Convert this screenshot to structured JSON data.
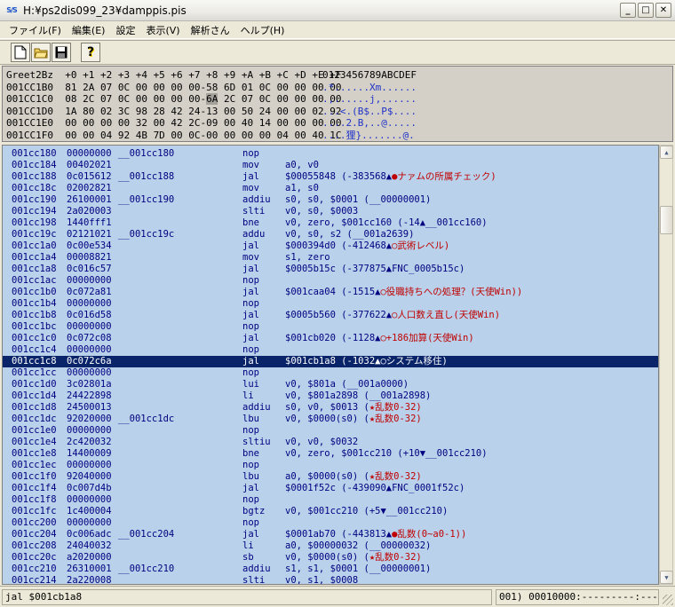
{
  "window": {
    "icon_text": "S/S",
    "title": "H:¥ps2dis099_23¥damppis.pis",
    "buttons": [
      "_",
      "□",
      "✕"
    ]
  },
  "menu": [
    "ファイル(F)",
    "編集(E)",
    "設定",
    "表示(V)",
    "解析さん",
    "ヘルプ(H)"
  ],
  "toolbar": {
    "icons": [
      "new-file-icon",
      "open-folder-icon",
      "save-disk-icon",
      "help-icon"
    ],
    "help_glyph": "?"
  },
  "dump": {
    "header": {
      "hex": "Greet2Bz  +0 +1 +2 +3 +4 +5 +6 +7 +8 +9 +A +B +C +D +E +F",
      "ascii": "0123456789ABCDEF"
    },
    "rows": [
      {
        "pre": "001CC1B0  81 2A 07 0C 00 00 00 00-58 6D 01 0C 00 00 00 00",
        "hl": "",
        "post": "",
        "ascii": ".*......Xm......"
      },
      {
        "pre": "001CC1C0  08 2C 07 0C 00 00 00 00-",
        "hl": "6A",
        "post": " 2C 07 0C 00 00 00 00",
        "ascii": ".,......j,......"
      },
      {
        "pre": "001CC1D0  1A 80 02 3C 98 28 42 24-13 00 50 24 00 00 02 92",
        "hl": "",
        "post": "",
        "ascii": "...<.(B$..P$...."
      },
      {
        "pre": "001CC1E0  00 00 00 00 32 00 42 2C-09 00 40 14 00 00 00 00",
        "hl": "",
        "post": "",
        "ascii": "....2.B,..@....."
      },
      {
        "pre": "001CC1F0  00 00 04 92 4B 7D 00 0C-00 00 00 00 04 00 40 1C",
        "hl": "",
        "post": "",
        "ascii": "....狸}.......@."
      }
    ]
  },
  "code": {
    "selected_index": 18,
    "rows": [
      {
        "addr": "001cc180",
        "word": "00000000",
        "label": "__001cc180",
        "op": "nop",
        "args": "",
        "comment": ""
      },
      {
        "addr": "001cc184",
        "word": "00402021",
        "label": "",
        "op": "mov",
        "args": "a0, v0",
        "comment": ""
      },
      {
        "addr": "001cc188",
        "word": "0c015612",
        "label": "__001cc188",
        "op": "jal",
        "args": "$00055848 (-383568▲",
        "comment": "●ナァムの所属チェック)"
      },
      {
        "addr": "001cc18c",
        "word": "02002821",
        "label": "",
        "op": "mov",
        "args": "a1, s0",
        "comment": ""
      },
      {
        "addr": "001cc190",
        "word": "26100001",
        "label": "__001cc190",
        "op": "addiu",
        "args": "s0, s0, $0001 (__00000001)",
        "comment": ""
      },
      {
        "addr": "001cc194",
        "word": "2a020003",
        "label": "",
        "op": "slti",
        "args": "v0, s0, $0003",
        "comment": ""
      },
      {
        "addr": "001cc198",
        "word": "1440fff1",
        "label": "",
        "op": "bne",
        "args": "v0, zero, $001cc160 (-14▲__001cc160)",
        "comment": ""
      },
      {
        "addr": "001cc19c",
        "word": "02121021",
        "label": "__001cc19c",
        "op": "addu",
        "args": "v0, s0, s2 (__001a2639)",
        "comment": ""
      },
      {
        "addr": "001cc1a0",
        "word": "0c00e534",
        "label": "",
        "op": "jal",
        "args": "$000394d0 (-412468▲",
        "comment": "○武術レベル)"
      },
      {
        "addr": "001cc1a4",
        "word": "00008821",
        "label": "",
        "op": "mov",
        "args": "s1, zero",
        "comment": ""
      },
      {
        "addr": "001cc1a8",
        "word": "0c016c57",
        "label": "",
        "op": "jal",
        "args": "$0005b15c (-377875▲FNC_0005b15c)",
        "comment": ""
      },
      {
        "addr": "001cc1ac",
        "word": "00000000",
        "label": "",
        "op": "nop",
        "args": "",
        "comment": ""
      },
      {
        "addr": "001cc1b0",
        "word": "0c072a81",
        "label": "",
        "op": "jal",
        "args": "$001caa04 (-1515▲",
        "comment": "○役職持ちへの処理？(天使Win))"
      },
      {
        "addr": "001cc1b4",
        "word": "00000000",
        "label": "",
        "op": "nop",
        "args": "",
        "comment": ""
      },
      {
        "addr": "001cc1b8",
        "word": "0c016d58",
        "label": "",
        "op": "jal",
        "args": "$0005b560 (-377622▲",
        "comment": "○人口数え直し(天使Win)"
      },
      {
        "addr": "001cc1bc",
        "word": "00000000",
        "label": "",
        "op": "nop",
        "args": "",
        "comment": ""
      },
      {
        "addr": "001cc1c0",
        "word": "0c072c08",
        "label": "",
        "op": "jal",
        "args": "$001cb020 (-1128▲",
        "comment": "○+186加算(天使Win)"
      },
      {
        "addr": "001cc1c4",
        "word": "00000000",
        "label": "",
        "op": "nop",
        "args": "",
        "comment": ""
      },
      {
        "addr": "001cc1c8",
        "word": "0c072c6a",
        "label": "",
        "op": "jal",
        "args": "$001cb1a8 (-1032▲",
        "comment": "○システム移住)"
      },
      {
        "addr": "001cc1cc",
        "word": "00000000",
        "label": "",
        "op": "nop",
        "args": "",
        "comment": ""
      },
      {
        "addr": "001cc1d0",
        "word": "3c02801a",
        "label": "",
        "op": "lui",
        "args": "v0, $801a (__001a0000)",
        "comment": ""
      },
      {
        "addr": "001cc1d4",
        "word": "24422898",
        "label": "",
        "op": "li",
        "args": "v0, $801a2898 (__001a2898)",
        "comment": ""
      },
      {
        "addr": "001cc1d8",
        "word": "24500013",
        "label": "",
        "op": "addiu",
        "args": "s0, v0, $0013 (",
        "comment": "★乱数0-32)"
      },
      {
        "addr": "001cc1dc",
        "word": "92020000",
        "label": "__001cc1dc",
        "op": "lbu",
        "args": "v0, $0000(s0) (",
        "comment": "★乱数0-32)"
      },
      {
        "addr": "001cc1e0",
        "word": "00000000",
        "label": "",
        "op": "nop",
        "args": "",
        "comment": ""
      },
      {
        "addr": "001cc1e4",
        "word": "2c420032",
        "label": "",
        "op": "sltiu",
        "args": "v0, v0, $0032",
        "comment": ""
      },
      {
        "addr": "001cc1e8",
        "word": "14400009",
        "label": "",
        "op": "bne",
        "args": "v0, zero, $001cc210 (+10▼__001cc210)",
        "comment": ""
      },
      {
        "addr": "001cc1ec",
        "word": "00000000",
        "label": "",
        "op": "nop",
        "args": "",
        "comment": ""
      },
      {
        "addr": "001cc1f0",
        "word": "92040000",
        "label": "",
        "op": "lbu",
        "args": "a0, $0000(s0) (",
        "comment": "★乱数0-32)"
      },
      {
        "addr": "001cc1f4",
        "word": "0c007d4b",
        "label": "",
        "op": "jal",
        "args": "$0001f52c (-439090▲FNC_0001f52c)",
        "comment": ""
      },
      {
        "addr": "001cc1f8",
        "word": "00000000",
        "label": "",
        "op": "nop",
        "args": "",
        "comment": ""
      },
      {
        "addr": "001cc1fc",
        "word": "1c400004",
        "label": "",
        "op": "bgtz",
        "args": "v0, $001cc210 (+5▼__001cc210)",
        "comment": ""
      },
      {
        "addr": "001cc200",
        "word": "00000000",
        "label": "",
        "op": "nop",
        "args": "",
        "comment": ""
      },
      {
        "addr": "001cc204",
        "word": "0c006adc",
        "label": "__001cc204",
        "op": "jal",
        "args": "$0001ab70 (-443813▲",
        "comment": "●乱数(0~a0-1))"
      },
      {
        "addr": "001cc208",
        "word": "24040032",
        "label": "",
        "op": "li",
        "args": "a0, $00000032 (__00000032)",
        "comment": ""
      },
      {
        "addr": "001cc20c",
        "word": "a2020000",
        "label": "",
        "op": "sb",
        "args": "v0, $0000(s0) (",
        "comment": "★乱数0-32)"
      },
      {
        "addr": "001cc210",
        "word": "26310001",
        "label": "__001cc210",
        "op": "addiu",
        "args": "s1, s1, $0001 (__00000001)",
        "comment": ""
      },
      {
        "addr": "001cc214",
        "word": "2a220008",
        "label": "",
        "op": "slti",
        "args": "v0, s1, $0008",
        "comment": ""
      }
    ]
  },
  "status": {
    "left": "jal $001cb1a8",
    "right": "001) 00010000:---------:---------"
  },
  "colors": {
    "code_bg": "#b9d1ea",
    "code_text": "#000080",
    "comment_red": "#c00000",
    "selection": "#0a246a"
  }
}
